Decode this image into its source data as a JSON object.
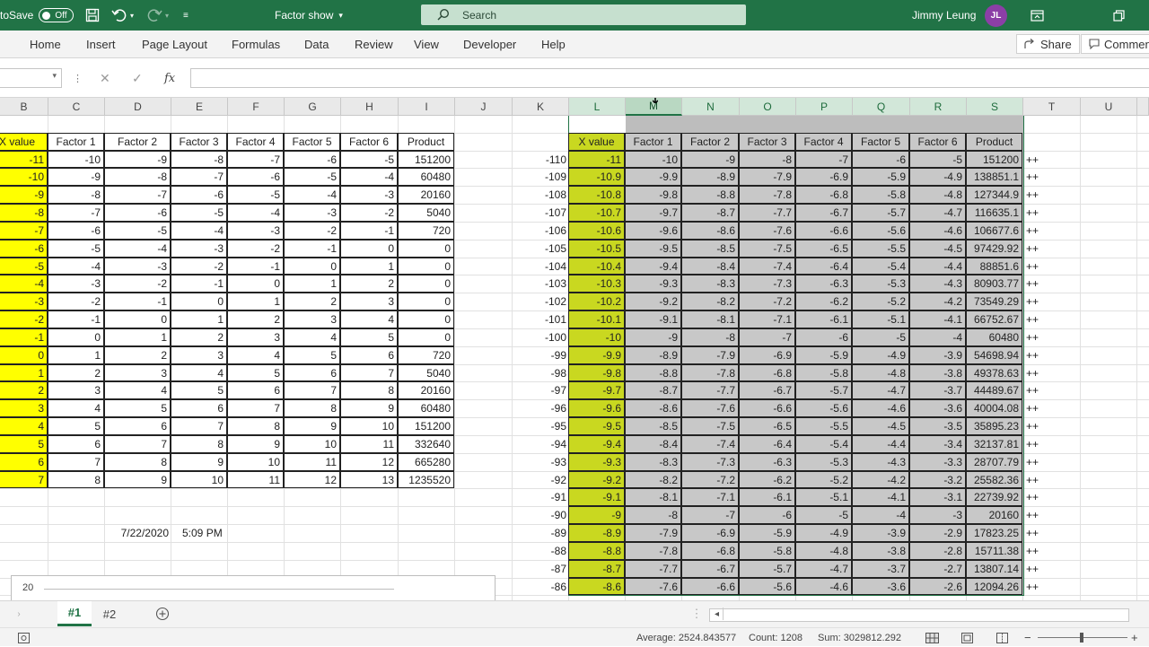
{
  "titlebar": {
    "autosave_label": "toSave",
    "autosave_state": "Off",
    "doc_title": "Factor show",
    "search_placeholder": "Search",
    "user_name": "Jimmy Leung",
    "user_initials": "JL"
  },
  "ribbon": {
    "tabs": [
      "Home",
      "Insert",
      "Page Layout",
      "Formulas",
      "Data",
      "Review",
      "View",
      "Developer",
      "Help"
    ],
    "share_label": "Share",
    "comments_label": "Commen"
  },
  "formula_bar": {
    "fx_label": "fx",
    "cancel_glyph": "✕",
    "enter_glyph": "✓"
  },
  "columns": [
    "B",
    "C",
    "D",
    "E",
    "F",
    "G",
    "H",
    "I",
    "J",
    "K",
    "L",
    "M",
    "N",
    "O",
    "P",
    "Q",
    "R",
    "S",
    "T",
    "U"
  ],
  "left_table": {
    "headers": [
      "X value",
      "Factor 1",
      "Factor 2",
      "Factor 3",
      "Factor 4",
      "Factor 5",
      "Factor 6",
      "Product"
    ],
    "rows": [
      [
        "-11",
        "-10",
        "-9",
        "-8",
        "-7",
        "-6",
        "-5",
        "151200"
      ],
      [
        "-10",
        "-9",
        "-8",
        "-7",
        "-6",
        "-5",
        "-4",
        "60480"
      ],
      [
        "-9",
        "-8",
        "-7",
        "-6",
        "-5",
        "-4",
        "-3",
        "20160"
      ],
      [
        "-8",
        "-7",
        "-6",
        "-5",
        "-4",
        "-3",
        "-2",
        "5040"
      ],
      [
        "-7",
        "-6",
        "-5",
        "-4",
        "-3",
        "-2",
        "-1",
        "720"
      ],
      [
        "-6",
        "-5",
        "-4",
        "-3",
        "-2",
        "-1",
        "0",
        "0"
      ],
      [
        "-5",
        "-4",
        "-3",
        "-2",
        "-1",
        "0",
        "1",
        "0"
      ],
      [
        "-4",
        "-3",
        "-2",
        "-1",
        "0",
        "1",
        "2",
        "0"
      ],
      [
        "-3",
        "-2",
        "-1",
        "0",
        "1",
        "2",
        "3",
        "0"
      ],
      [
        "-2",
        "-1",
        "0",
        "1",
        "2",
        "3",
        "4",
        "0"
      ],
      [
        "-1",
        "0",
        "1",
        "2",
        "3",
        "4",
        "5",
        "0"
      ],
      [
        "0",
        "1",
        "2",
        "3",
        "4",
        "5",
        "6",
        "720"
      ],
      [
        "1",
        "2",
        "3",
        "4",
        "5",
        "6",
        "7",
        "5040"
      ],
      [
        "2",
        "3",
        "4",
        "5",
        "6",
        "7",
        "8",
        "20160"
      ],
      [
        "3",
        "4",
        "5",
        "6",
        "7",
        "8",
        "9",
        "60480"
      ],
      [
        "4",
        "5",
        "6",
        "7",
        "8",
        "9",
        "10",
        "151200"
      ],
      [
        "5",
        "6",
        "7",
        "8",
        "9",
        "10",
        "11",
        "332640"
      ],
      [
        "6",
        "7",
        "8",
        "9",
        "10",
        "11",
        "12",
        "665280"
      ],
      [
        "7",
        "8",
        "9",
        "10",
        "11",
        "12",
        "13",
        "1235520"
      ]
    ],
    "date": "7/22/2020",
    "time": "5:09 PM",
    "chart_label": "20"
  },
  "right_table": {
    "headers": [
      "X value",
      "Factor 1",
      "Factor 2",
      "Factor 3",
      "Factor 4",
      "Factor 5",
      "Factor 6",
      "Product"
    ],
    "rows": [
      [
        "-110",
        "-11",
        "-10",
        "-9",
        "-8",
        "-7",
        "-6",
        "-5",
        "151200",
        "++"
      ],
      [
        "-109",
        "-10.9",
        "-9.9",
        "-8.9",
        "-7.9",
        "-6.9",
        "-5.9",
        "-4.9",
        "138851.1",
        "++"
      ],
      [
        "-108",
        "-10.8",
        "-9.8",
        "-8.8",
        "-7.8",
        "-6.8",
        "-5.8",
        "-4.8",
        "127344.9",
        "++"
      ],
      [
        "-107",
        "-10.7",
        "-9.7",
        "-8.7",
        "-7.7",
        "-6.7",
        "-5.7",
        "-4.7",
        "116635.1",
        "++"
      ],
      [
        "-106",
        "-10.6",
        "-9.6",
        "-8.6",
        "-7.6",
        "-6.6",
        "-5.6",
        "-4.6",
        "106677.6",
        "++"
      ],
      [
        "-105",
        "-10.5",
        "-9.5",
        "-8.5",
        "-7.5",
        "-6.5",
        "-5.5",
        "-4.5",
        "97429.92",
        "++"
      ],
      [
        "-104",
        "-10.4",
        "-9.4",
        "-8.4",
        "-7.4",
        "-6.4",
        "-5.4",
        "-4.4",
        "88851.6",
        "++"
      ],
      [
        "-103",
        "-10.3",
        "-9.3",
        "-8.3",
        "-7.3",
        "-6.3",
        "-5.3",
        "-4.3",
        "80903.77",
        "++"
      ],
      [
        "-102",
        "-10.2",
        "-9.2",
        "-8.2",
        "-7.2",
        "-6.2",
        "-5.2",
        "-4.2",
        "73549.29",
        "++"
      ],
      [
        "-101",
        "-10.1",
        "-9.1",
        "-8.1",
        "-7.1",
        "-6.1",
        "-5.1",
        "-4.1",
        "66752.67",
        "++"
      ],
      [
        "-100",
        "-10",
        "-9",
        "-8",
        "-7",
        "-6",
        "-5",
        "-4",
        "60480",
        "++"
      ],
      [
        "-99",
        "-9.9",
        "-8.9",
        "-7.9",
        "-6.9",
        "-5.9",
        "-4.9",
        "-3.9",
        "54698.94",
        "++"
      ],
      [
        "-98",
        "-9.8",
        "-8.8",
        "-7.8",
        "-6.8",
        "-5.8",
        "-4.8",
        "-3.8",
        "49378.63",
        "++"
      ],
      [
        "-97",
        "-9.7",
        "-8.7",
        "-7.7",
        "-6.7",
        "-5.7",
        "-4.7",
        "-3.7",
        "44489.67",
        "++"
      ],
      [
        "-96",
        "-9.6",
        "-8.6",
        "-7.6",
        "-6.6",
        "-5.6",
        "-4.6",
        "-3.6",
        "40004.08",
        "++"
      ],
      [
        "-95",
        "-9.5",
        "-8.5",
        "-7.5",
        "-6.5",
        "-5.5",
        "-4.5",
        "-3.5",
        "35895.23",
        "++"
      ],
      [
        "-94",
        "-9.4",
        "-8.4",
        "-7.4",
        "-6.4",
        "-5.4",
        "-4.4",
        "-3.4",
        "32137.81",
        "++"
      ],
      [
        "-93",
        "-9.3",
        "-8.3",
        "-7.3",
        "-6.3",
        "-5.3",
        "-4.3",
        "-3.3",
        "28707.79",
        "++"
      ],
      [
        "-92",
        "-9.2",
        "-8.2",
        "-7.2",
        "-6.2",
        "-5.2",
        "-4.2",
        "-3.2",
        "25582.36",
        "++"
      ],
      [
        "-91",
        "-9.1",
        "-8.1",
        "-7.1",
        "-6.1",
        "-5.1",
        "-4.1",
        "-3.1",
        "22739.92",
        "++"
      ],
      [
        "-90",
        "-9",
        "-8",
        "-7",
        "-6",
        "-5",
        "-4",
        "-3",
        "20160",
        "++"
      ],
      [
        "-89",
        "-8.9",
        "-7.9",
        "-6.9",
        "-5.9",
        "-4.9",
        "-3.9",
        "-2.9",
        "17823.25",
        "++"
      ],
      [
        "-88",
        "-8.8",
        "-7.8",
        "-6.8",
        "-5.8",
        "-4.8",
        "-3.8",
        "-2.8",
        "15711.38",
        "++"
      ],
      [
        "-87",
        "-8.7",
        "-7.7",
        "-6.7",
        "-5.7",
        "-4.7",
        "-3.7",
        "-2.7",
        "13807.14",
        "++"
      ],
      [
        "-86",
        "-8.6",
        "-7.6",
        "-6.6",
        "-5.6",
        "-4.6",
        "-3.6",
        "-2.6",
        "12094.26",
        "++"
      ]
    ]
  },
  "sheets": {
    "tabs": [
      "#1",
      "#2"
    ],
    "active": "#1"
  },
  "statusbar": {
    "average": "Average: 2524.843577",
    "count": "Count: 1208",
    "sum": "Sum: 3029812.292",
    "zoom_out": "−",
    "zoom_in": "+"
  },
  "colors": {
    "excel_green": "#217346",
    "yellow": "#ffff00",
    "lime": "#c9d820",
    "selection_grey": "#c8c8c8"
  }
}
